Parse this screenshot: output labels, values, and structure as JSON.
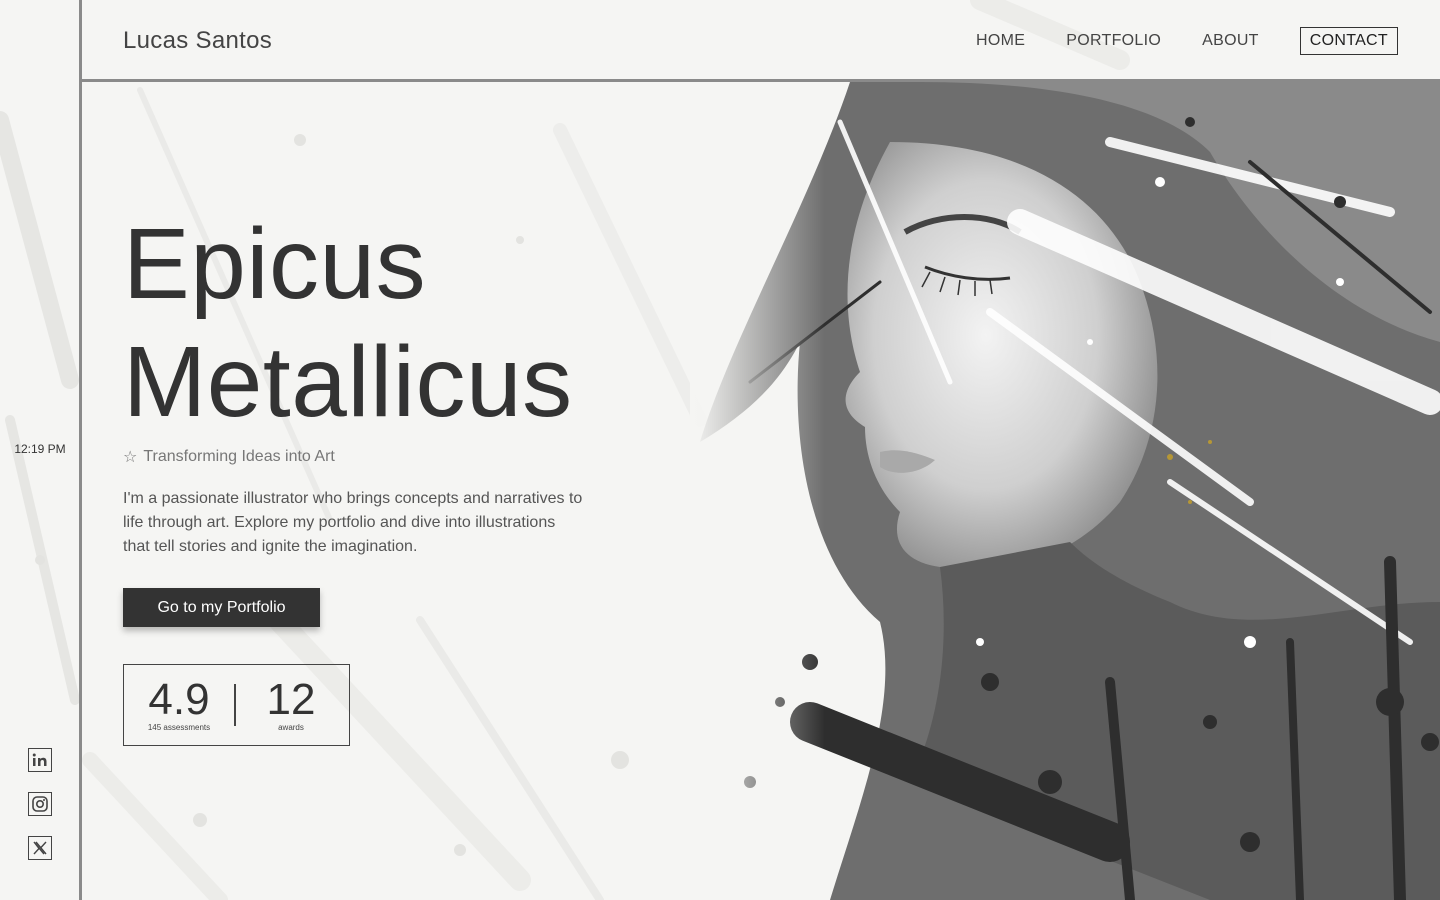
{
  "header": {
    "brand": "Lucas Santos",
    "nav": [
      "HOME",
      "PORTFOLIO",
      "ABOUT",
      "CONTACT"
    ]
  },
  "rail": {
    "time": "12:19 PM",
    "social": [
      "linkedin-icon",
      "instagram-icon",
      "x-icon"
    ]
  },
  "hero": {
    "title_line1": "Epicus",
    "title_line2": "Metallicus",
    "tagline_icon": "star-icon",
    "tagline": "Transforming Ideas into Art",
    "description": "I'm a passionate illustrator who brings concepts and narratives to life through art. Explore my portfolio and dive into illustrations that tell stories and ignite the imagination.",
    "cta_label": "Go to my Portfolio"
  },
  "stats": [
    {
      "value": "4.9",
      "label": "145 assessments"
    },
    {
      "value": "12",
      "label": "awards"
    }
  ],
  "colors": {
    "background": "#f5f5f3",
    "text": "#333333",
    "button": "#333333",
    "border": "#8a8a8a"
  }
}
